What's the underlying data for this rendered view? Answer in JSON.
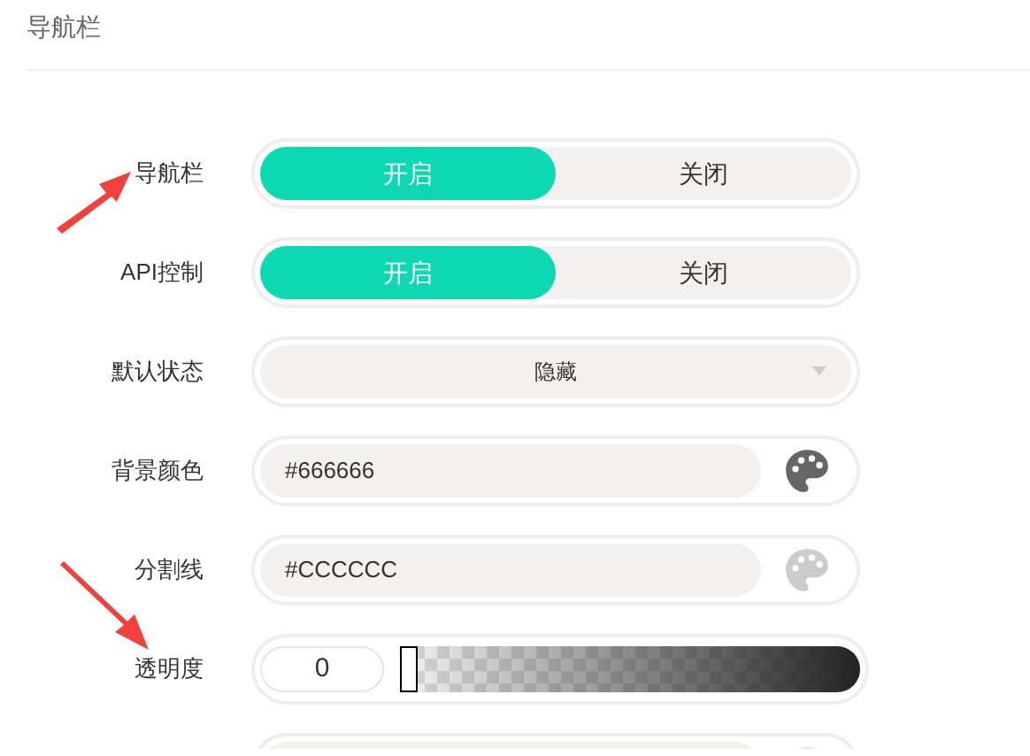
{
  "section_title": "导航栏",
  "rows": [
    {
      "kind": "toggle",
      "label": "导航栏",
      "arrow": true,
      "arrow_up": true,
      "options": [
        {
          "label": "开启",
          "selected": true
        },
        {
          "label": "关闭",
          "selected": false
        }
      ]
    },
    {
      "kind": "toggle",
      "label": "API控制",
      "options": [
        {
          "label": "开启",
          "selected": true
        },
        {
          "label": "关闭",
          "selected": false
        }
      ]
    },
    {
      "kind": "select",
      "label": "默认状态",
      "value": "隐藏"
    },
    {
      "kind": "color",
      "label": "背景颜色",
      "value": "#666666"
    },
    {
      "kind": "color",
      "label": "分割线",
      "value": "#CCCCCC"
    },
    {
      "kind": "slider",
      "label": "透明度",
      "arrow": true,
      "arrow_up": false,
      "value": "0",
      "level": 0
    },
    {
      "kind": "color"
    }
  ]
}
